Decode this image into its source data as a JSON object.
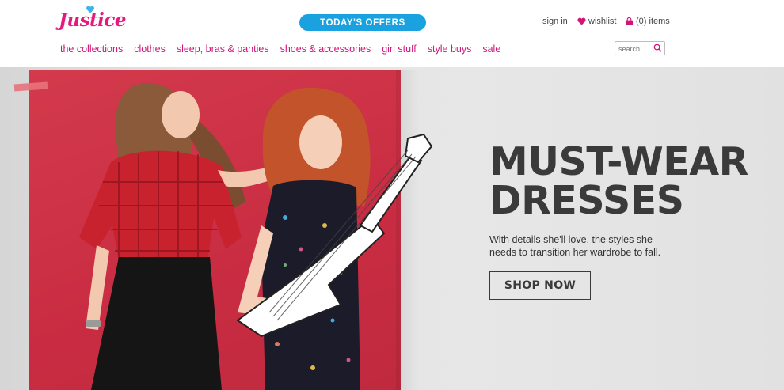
{
  "brand": {
    "logo_text": "Justice"
  },
  "header": {
    "offers_label": "TODAY'S OFFERS",
    "sign_in": "sign in",
    "wishlist": "wishlist",
    "bag_count": "(0) items"
  },
  "nav": {
    "items": [
      {
        "label": "the collections"
      },
      {
        "label": "clothes"
      },
      {
        "label": "sleep, bras & panties"
      },
      {
        "label": "shoes & accessories"
      },
      {
        "label": "girl stuff"
      },
      {
        "label": "style buys"
      },
      {
        "label": "sale"
      }
    ]
  },
  "search": {
    "placeholder": "search"
  },
  "hero": {
    "title_line1": "MUST-WEAR",
    "title_line2": "DRESSES",
    "subtitle": "With details she'll love, the styles she needs to transition her wardrobe to fall.",
    "cta": "SHOP NOW"
  },
  "colors": {
    "brand_pink": "#d0147a",
    "offers_blue": "#1aa2e0",
    "hero_red": "#c92c42",
    "hero_text": "#3a3a3a"
  },
  "icons": [
    "heart-icon",
    "shopping-bag-icon",
    "search-icon"
  ]
}
